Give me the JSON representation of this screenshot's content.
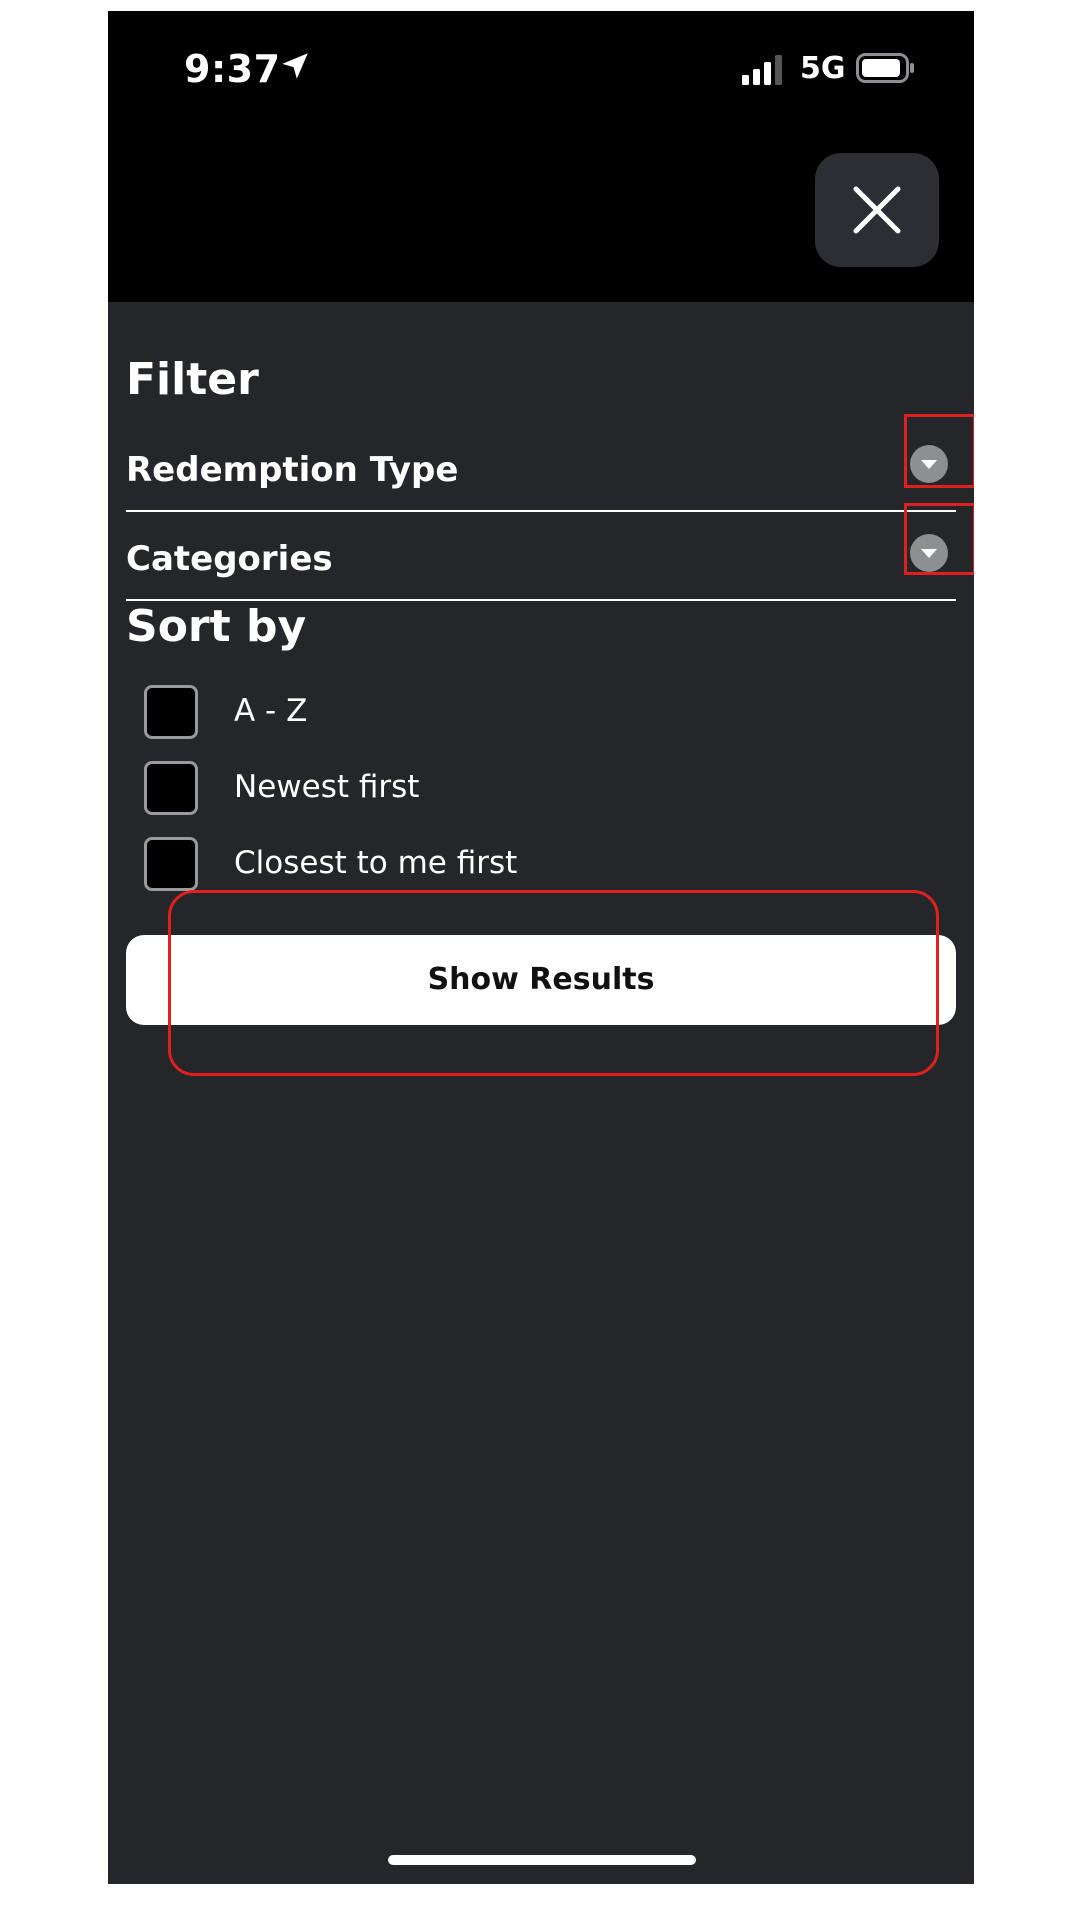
{
  "status_bar": {
    "time": "9:37",
    "network": "5G"
  },
  "icons": {
    "location": "location-arrow-icon",
    "signal": "signal-bars-icon",
    "battery": "battery-icon",
    "close": "close-icon",
    "chevron": "chevron-down-icon"
  },
  "filter": {
    "title": "Filter",
    "sections": [
      {
        "label": "Redemption Type"
      },
      {
        "label": "Categories"
      }
    ]
  },
  "sort": {
    "title": "Sort by",
    "options": [
      {
        "label": "A - Z",
        "checked": false
      },
      {
        "label": "Newest first",
        "checked": false
      },
      {
        "label": "Closest to me first",
        "checked": false
      }
    ]
  },
  "actions": {
    "show_results_label": "Show Results"
  },
  "colors": {
    "background": "#25262a",
    "header": "#000000",
    "annotation": "#e01f1f",
    "button": "#ffffff"
  }
}
